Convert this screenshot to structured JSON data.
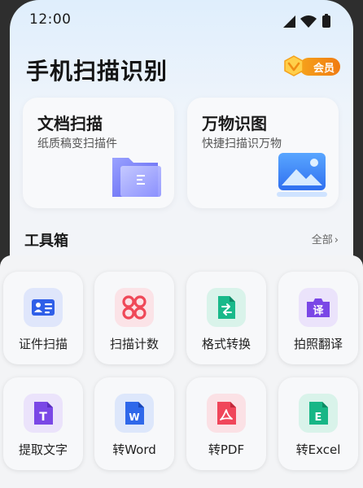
{
  "status": {
    "time": "12:00"
  },
  "header": {
    "title": "手机扫描识别",
    "vip_label": "会员"
  },
  "cards": [
    {
      "title": "文档扫描",
      "subtitle": "纸质稿变扫描件",
      "icon": "folder-icon"
    },
    {
      "title": "万物识图",
      "subtitle": "快捷扫描识万物",
      "icon": "image-icon"
    }
  ],
  "toolbox": {
    "title": "工具箱",
    "all_label": "全部",
    "tools": [
      {
        "label": "证件扫描",
        "icon": "id-card-icon"
      },
      {
        "label": "扫描计数",
        "icon": "count-icon"
      },
      {
        "label": "格式转换",
        "icon": "convert-icon"
      },
      {
        "label": "拍照翻译",
        "icon": "translate-icon",
        "glyph": "译"
      },
      {
        "label": "提取文字",
        "icon": "text-extract-icon",
        "glyph": "T"
      },
      {
        "label": "转Word",
        "icon": "word-icon",
        "glyph": "W"
      },
      {
        "label": "转PDF",
        "icon": "pdf-icon"
      },
      {
        "label": "转Excel",
        "icon": "excel-icon",
        "glyph": "E"
      }
    ]
  },
  "colors": {
    "accent_blue": "#3b63ea",
    "vip_orange": "#f5901a",
    "count_red": "#f04b55",
    "convert_green": "#19b98a",
    "translate_purple": "#7a47e6",
    "pdf_red": "#f0465a",
    "excel_green": "#17b686"
  }
}
